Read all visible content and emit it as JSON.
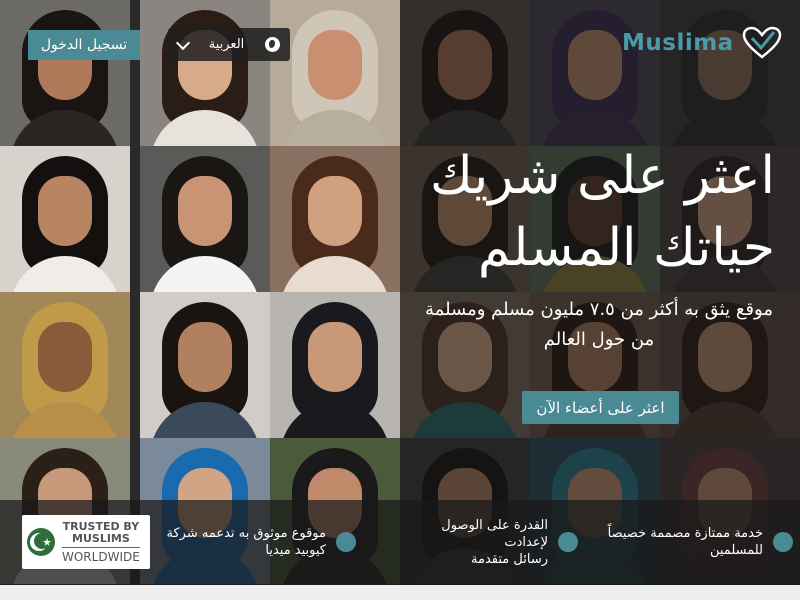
{
  "header": {
    "login_label": "تسجيل الدخول",
    "language_label": "العربية",
    "logo_text": "Muslima"
  },
  "hero": {
    "headline_line1": "اعثر على شريك",
    "headline_line2": "حياتك المسلم",
    "subline_line1": "موقع يثق به أكثر من ٧.٥ مليون مسلم ومسلمة",
    "subline_line2": "من حول العالم",
    "cta_label": "اعثر على أعضاء الآن"
  },
  "features": [
    {
      "line1": "خدمة ممتازة مصممة خصيصاً",
      "line2": "للمسلمين"
    },
    {
      "line1": "القدرة على الوصول لإعدادت",
      "line2": "رسائل متقدمة"
    },
    {
      "line1": "موقوع موثوق به تدعمه شركة",
      "line2": "كيوبيد ميديا"
    }
  ],
  "trust_badge": {
    "top_line1": "TRUSTED BY",
    "top_line2": "MUSLIMS",
    "bottom": "WORLDWIDE"
  },
  "colors": {
    "accent": "#4a8a94",
    "logo": "#4a9aa8"
  },
  "icons": {
    "globe": "globe-icon",
    "chevron": "chevron-down-icon",
    "logo_heart": "heart-icon",
    "seal": "crescent-star-icon"
  }
}
